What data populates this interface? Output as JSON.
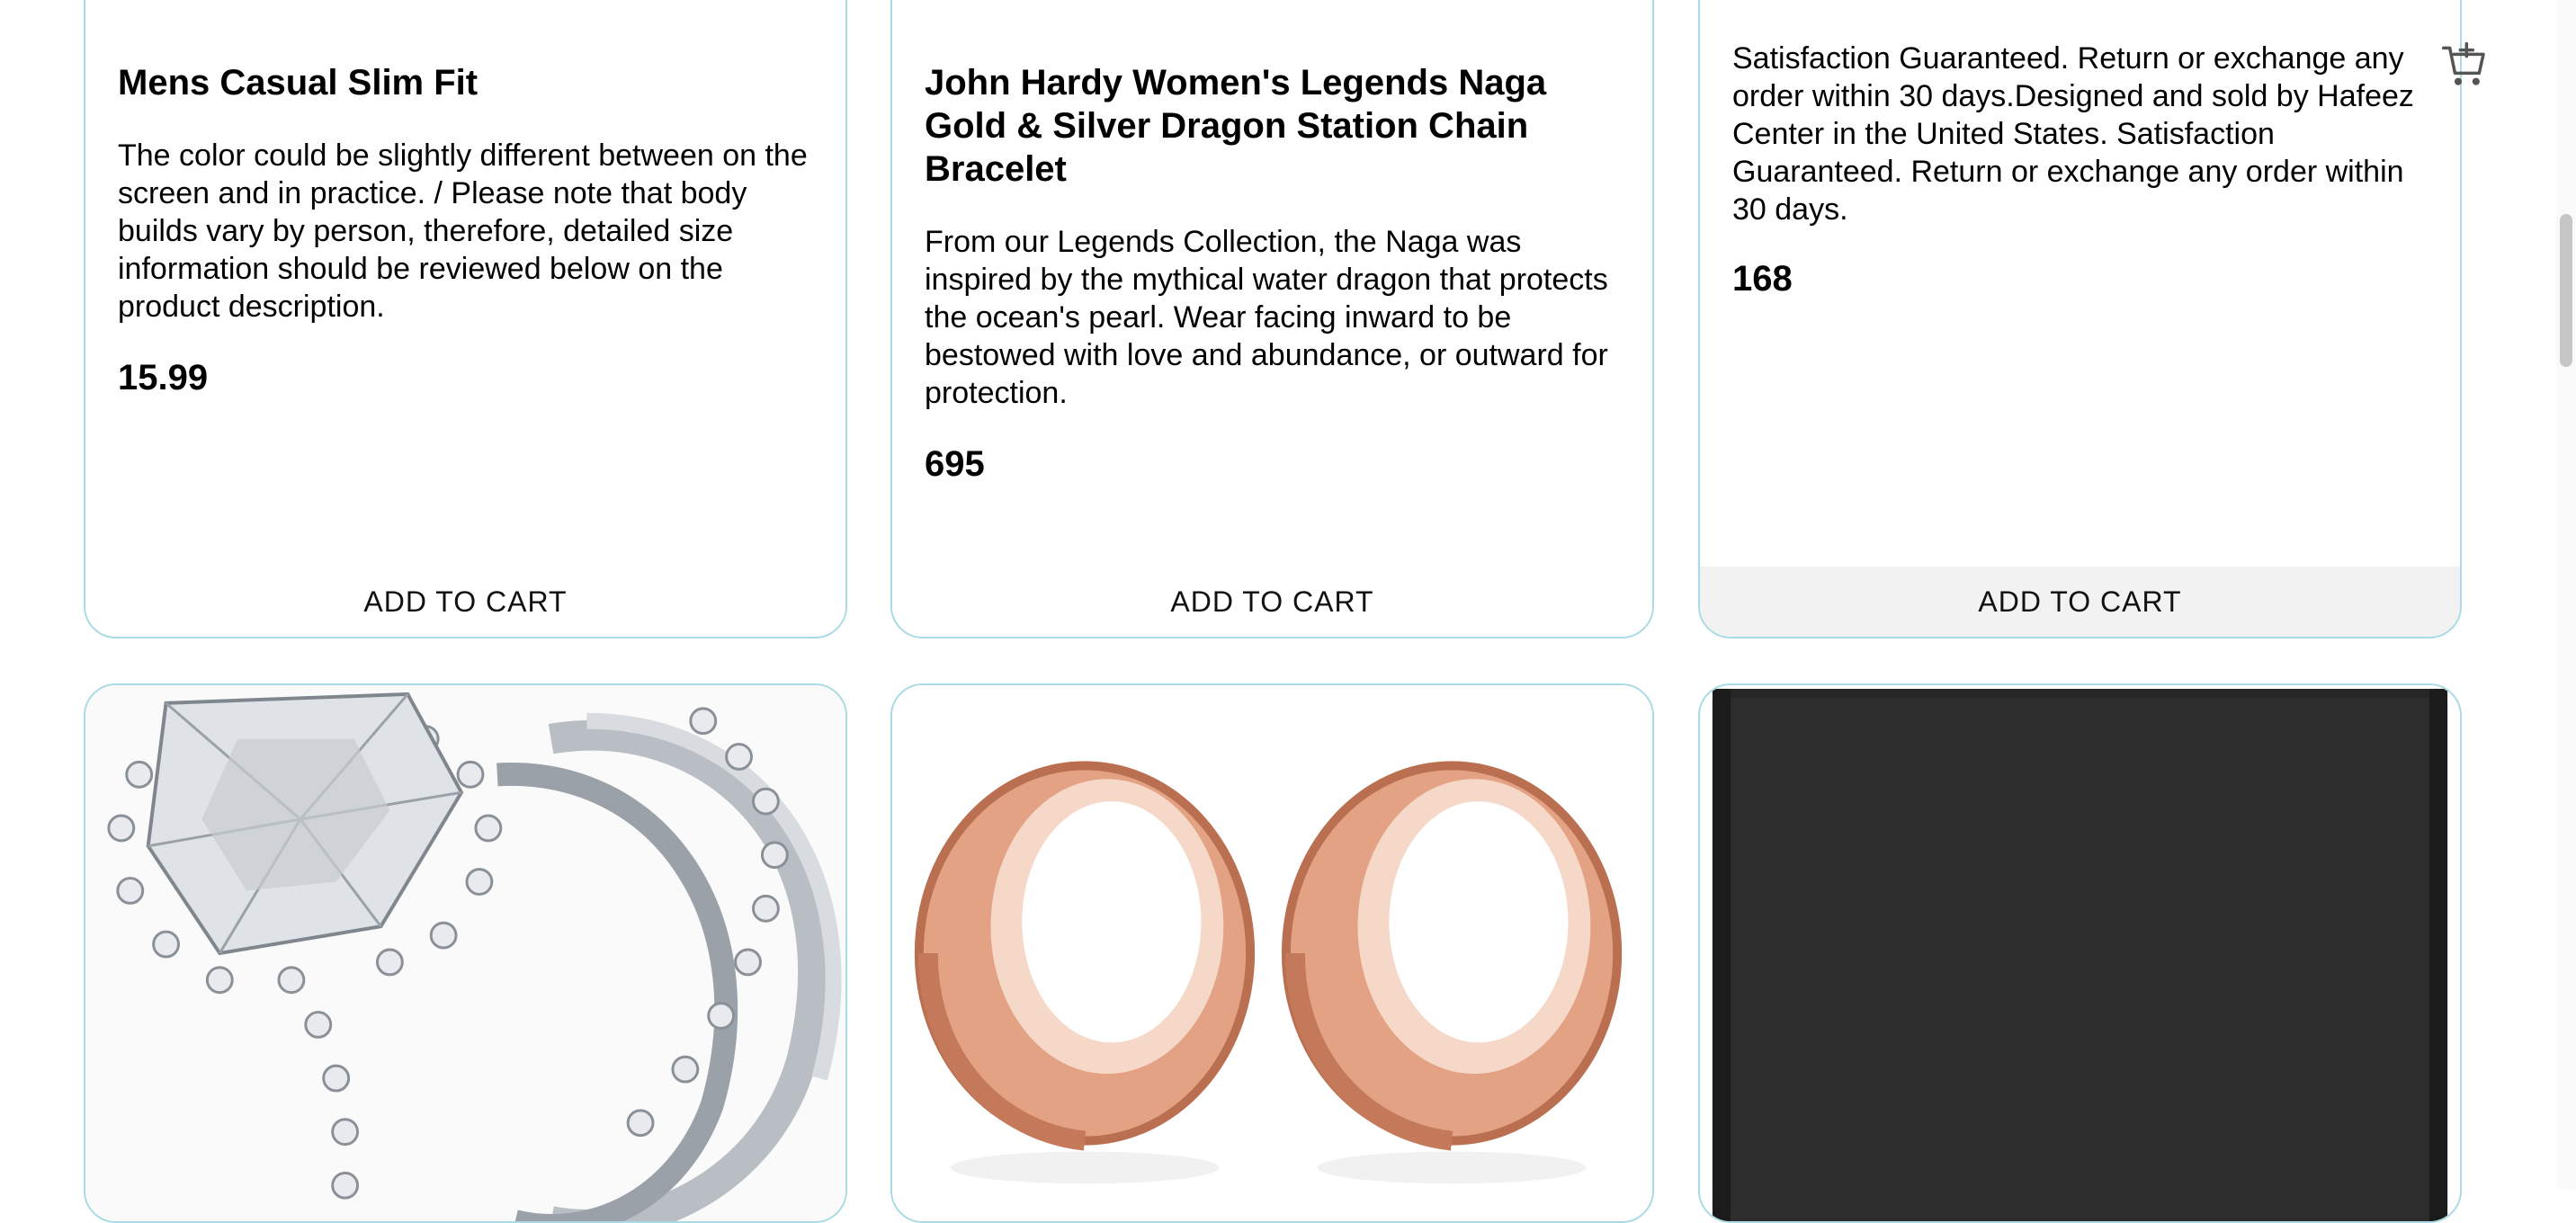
{
  "products": [
    {
      "title": "Mens Casual Slim Fit",
      "description": "The color could be slightly different between on the screen and in practice. / Please note that body builds vary by person, therefore, detailed size information should be reviewed below on the product description.",
      "price": "15.99",
      "cta": "ADD TO CART"
    },
    {
      "title": "John Hardy Women's Legends Naga Gold & Silver Dragon Station Chain Bracelet",
      "description": "From our Legends Collection, the Naga was inspired by the mythical water dragon that protects the ocean's pearl. Wear facing inward to be bestowed with love and abundance, or outward for protection.",
      "price": "695",
      "cta": "ADD TO CART"
    },
    {
      "title": "",
      "description": "Satisfaction Guaranteed. Return or exchange any order within 30 days.Designed and sold by Hafeez Center in the United States. Satisfaction Guaranteed. Return or exchange any order within 30 days.",
      "price": "168",
      "cta": "ADD TO CART"
    }
  ],
  "next_row_images": [
    {
      "icon": "ring-image"
    },
    {
      "icon": "rose-gold-plugs-image"
    },
    {
      "icon": "black-device-image"
    }
  ],
  "colors": {
    "card_border": "#a9dbe6",
    "cart_hover_bg": "#f2f2f2",
    "rose_gold": "#e4a383"
  }
}
